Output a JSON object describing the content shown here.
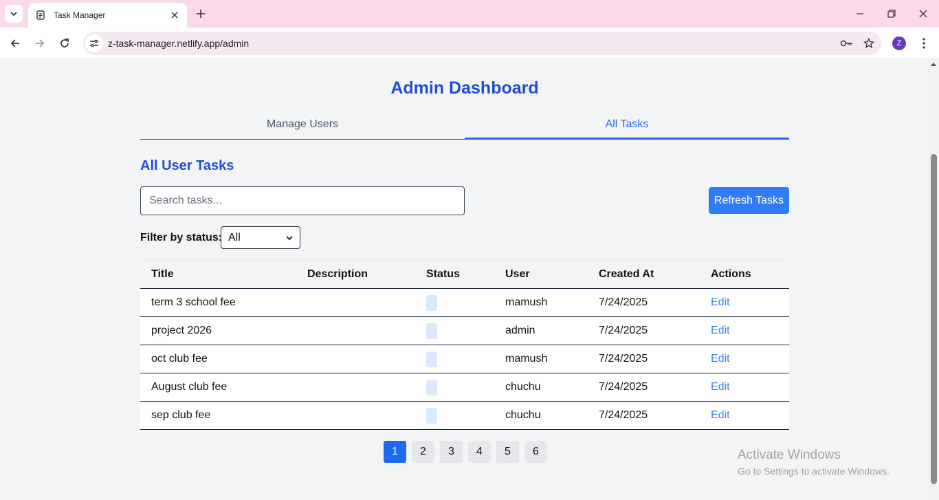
{
  "browser": {
    "tab_title": "Task Manager",
    "url": "z-task-manager.netlify.app/admin",
    "avatar_letter": "Z"
  },
  "page": {
    "title": "Admin Dashboard",
    "tabs": [
      {
        "label": "Manage Users",
        "active": false
      },
      {
        "label": "All Tasks",
        "active": true
      }
    ],
    "section_title": "All User Tasks",
    "search": {
      "placeholder": "Search tasks...",
      "value": ""
    },
    "refresh_label": "Refresh Tasks",
    "filter": {
      "label": "Filter by status:",
      "selected": "All"
    },
    "table": {
      "headers": [
        "Title",
        "Description",
        "Status",
        "User",
        "Created At",
        "Actions"
      ],
      "rows": [
        {
          "title": "term 3 school fee",
          "description": "",
          "status": "",
          "user": "mamush",
          "created": "7/24/2025",
          "action": "Edit"
        },
        {
          "title": "project 2026",
          "description": "",
          "status": "",
          "user": "admin",
          "created": "7/24/2025",
          "action": "Edit"
        },
        {
          "title": "oct club fee",
          "description": "",
          "status": "",
          "user": "mamush",
          "created": "7/24/2025",
          "action": "Edit"
        },
        {
          "title": "August club fee",
          "description": "",
          "status": "",
          "user": "chuchu",
          "created": "7/24/2025",
          "action": "Edit"
        },
        {
          "title": "sep club fee",
          "description": "",
          "status": "",
          "user": "chuchu",
          "created": "7/24/2025",
          "action": "Edit"
        }
      ]
    },
    "pagination": [
      "1",
      "2",
      "3",
      "4",
      "5",
      "6"
    ],
    "current_page": "1"
  },
  "watermark": {
    "title": "Activate Windows",
    "subtitle": "Go to Settings to activate Windows."
  },
  "colors": {
    "accent": "#2563eb",
    "title": "#1d4ed8",
    "tabbar": "#fbd9ea"
  }
}
